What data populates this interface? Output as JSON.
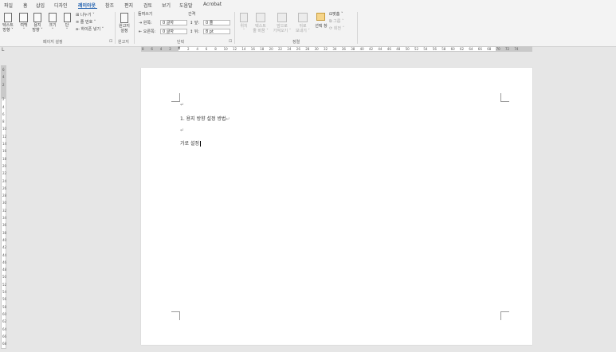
{
  "tabs": [
    "파일",
    "홈",
    "삽입",
    "디자인",
    "레이아웃",
    "참조",
    "편지",
    "검토",
    "보기",
    "도움말",
    "Acrobat"
  ],
  "active_tab": "레이아웃",
  "page_setup": {
    "text_direction": [
      "텍스트",
      "방향 ˅"
    ],
    "margins": [
      "여백",
      "˅"
    ],
    "orientation": [
      "용지",
      "방향 ˅"
    ],
    "size": [
      "크기",
      "˅"
    ],
    "columns": [
      "단",
      "˅"
    ],
    "breaks": "나누기 ˅",
    "line_numbers": "줄 번호 ˅",
    "hyphenation": "하이픈 넣기 ˅",
    "group_label": "페이지 설정",
    "launcher": "⊡"
  },
  "manuscript": {
    "button": [
      "원고지",
      "설정"
    ],
    "group_label": "원고지"
  },
  "paragraph": {
    "indent_title": "들여쓰기",
    "spacing_title": "간격",
    "left_label": "왼쪽:",
    "left_value": "0 글자",
    "right_label": "오른쪽:",
    "right_value": "0 글자",
    "before_label": "앞:",
    "before_value": "0 줄",
    "after_label": "뒤:",
    "after_value": "8 pt",
    "group_label": "단락",
    "launcher": "⊡"
  },
  "arrange": {
    "position": [
      "위치",
      "˅"
    ],
    "wrap_text": [
      "텍스트",
      "줄 바꿈 ˅"
    ],
    "bring_forward": [
      "앞으로",
      "가져오기 ˅"
    ],
    "send_backward": [
      "뒤로",
      "보내기 ˅"
    ],
    "selection_pane": "선택 창",
    "align": "맞춤 ˅",
    "group": "그룹 ˅",
    "rotate": "회전 ˅",
    "group_label": "정렬"
  },
  "ruler_h_numbers": [
    "8",
    "6",
    "4",
    "2",
    "",
    "2",
    "4",
    "6",
    "8",
    "10",
    "12",
    "14",
    "16",
    "18",
    "20",
    "22",
    "24",
    "26",
    "28",
    "30",
    "32",
    "34",
    "36",
    "38",
    "40",
    "42",
    "44",
    "46",
    "48",
    "50",
    "52",
    "54",
    "56",
    "58",
    "60",
    "62",
    "64",
    "66",
    "68",
    "70",
    "72",
    "74"
  ],
  "ruler_v_numbers": [
    "6",
    "4",
    "2",
    "",
    "2",
    "4",
    "6",
    "8",
    "10",
    "12",
    "14",
    "16",
    "18",
    "20",
    "22",
    "24",
    "26",
    "28",
    "30",
    "32",
    "34",
    "36",
    "38",
    "40",
    "42",
    "44",
    "46",
    "48",
    "50",
    "52",
    "54",
    "56",
    "58",
    "60",
    "62",
    "64",
    "66",
    "68"
  ],
  "ruler_corner": "L",
  "document": {
    "lines": [
      {
        "text": "",
        "mark": "↵"
      },
      {
        "text": "1. 용지 방향 설정 방법",
        "mark": "↵"
      },
      {
        "text": "",
        "mark": "↵"
      },
      {
        "text": "가로 설정",
        "mark": ""
      }
    ]
  }
}
